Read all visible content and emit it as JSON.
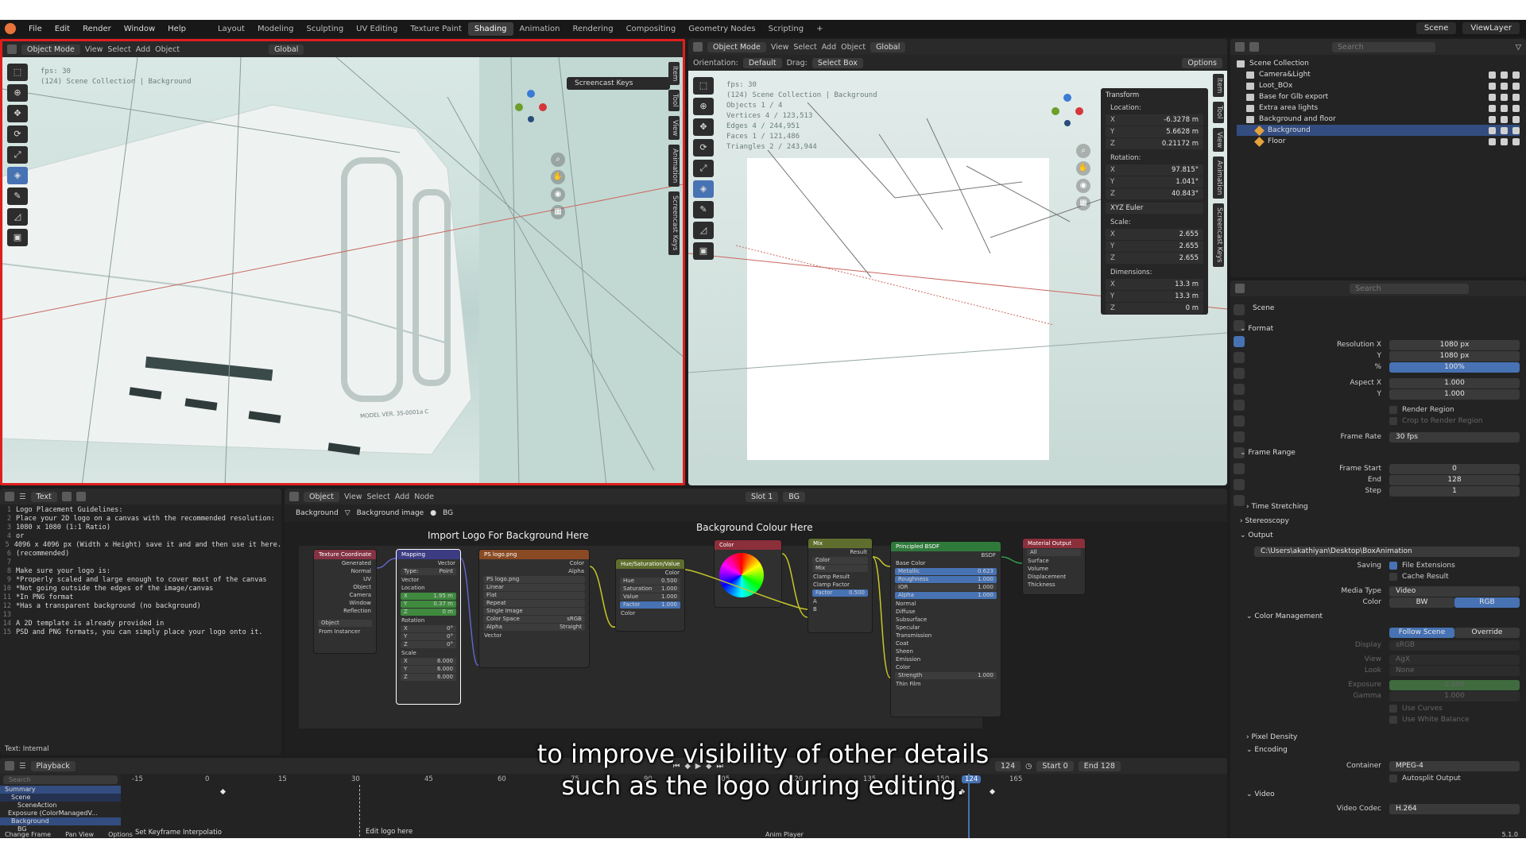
{
  "topbar": {
    "menus": [
      "File",
      "Edit",
      "Render",
      "Window",
      "Help"
    ],
    "workspaces": [
      "Layout",
      "Modeling",
      "Sculpting",
      "UV Editing",
      "Texture Paint",
      "Shading",
      "Animation",
      "Rendering",
      "Compositing",
      "Geometry Nodes",
      "Scripting"
    ],
    "active_workspace": "Shading",
    "scene": "Scene",
    "view_layer": "ViewLayer"
  },
  "viewport_left": {
    "mode": "Object Mode",
    "menus": [
      "View",
      "Select",
      "Add",
      "Object"
    ],
    "transform": "Global",
    "info_fps": "fps: 30",
    "info_collection": "(124) Scene Collection | Background",
    "screencast": "Screencast Keys",
    "side_tabs": [
      "Item",
      "Tool",
      "View",
      "Animation",
      "Screencast Keys"
    ],
    "model_text": "MODEL VER. 3S-0001a C"
  },
  "viewport_right": {
    "mode": "Object Mode",
    "menus": [
      "View",
      "Select",
      "Add",
      "Object"
    ],
    "transform": "Global",
    "orientation_label": "Orientation:",
    "orientation": "Default",
    "drag_label": "Drag:",
    "drag": "Select Box",
    "options": "Options",
    "info_lines": [
      "fps: 30",
      "(124) Scene Collection | Background",
      "Objects   1 / 4",
      "Vertices   4 / 123,513",
      "Edges   4 / 244,951",
      "Faces   1 / 121,486",
      "Triangles   2 / 243,944"
    ],
    "side_tabs": [
      "Item",
      "Tool",
      "View",
      "Animation",
      "Screencast Keys"
    ]
  },
  "transform_panel": {
    "title": "Transform",
    "location_label": "Location:",
    "location": [
      {
        "k": "X",
        "v": "-6.3278 m"
      },
      {
        "k": "Y",
        "v": "5.6628 m"
      },
      {
        "k": "Z",
        "v": "0.21172 m"
      }
    ],
    "rotation_label": "Rotation:",
    "rotation": [
      {
        "k": "X",
        "v": "97.815°"
      },
      {
        "k": "Y",
        "v": "1.041°"
      },
      {
        "k": "Z",
        "v": "40.843°"
      }
    ],
    "rotation_mode": "XYZ Euler",
    "scale_label": "Scale:",
    "scale": [
      {
        "k": "X",
        "v": "2.655"
      },
      {
        "k": "Y",
        "v": "2.655"
      },
      {
        "k": "Z",
        "v": "2.655"
      }
    ],
    "dimensions_label": "Dimensions:",
    "dimensions": [
      {
        "k": "X",
        "v": "13.3 m"
      },
      {
        "k": "Y",
        "v": "13.3 m"
      },
      {
        "k": "Z",
        "v": "0 m"
      }
    ]
  },
  "outliner": {
    "search_placeholder": "Search",
    "root": "Scene Collection",
    "items": [
      {
        "label": "Camera&Light",
        "indent": 1,
        "type": "coll"
      },
      {
        "label": "Loot_BOx",
        "indent": 1,
        "type": "coll"
      },
      {
        "label": "Base for Glb export",
        "indent": 1,
        "type": "coll"
      },
      {
        "label": "Extra area lights",
        "indent": 1,
        "type": "coll"
      },
      {
        "label": "Background and floor",
        "indent": 1,
        "type": "coll"
      },
      {
        "label": "Background",
        "indent": 2,
        "type": "obj",
        "selected": true
      },
      {
        "label": "Floor",
        "indent": 2,
        "type": "obj"
      }
    ]
  },
  "properties": {
    "search_placeholder": "Search",
    "context": "Scene",
    "format": "Format",
    "resolution_x_label": "Resolution X",
    "resolution_x": "1080 px",
    "resolution_y_label": "Y",
    "resolution_y": "1080 px",
    "percent_label": "%",
    "percent": "100%",
    "aspect_x_label": "Aspect X",
    "aspect_x": "1.000",
    "aspect_y_label": "Y",
    "aspect_y": "1.000",
    "render_region": "Render Region",
    "crop_region": "Crop to Render Region",
    "frame_rate_label": "Frame Rate",
    "frame_rate": "30 fps",
    "frame_range": "Frame Range",
    "frame_start_label": "Frame Start",
    "frame_start": "0",
    "frame_end_label": "End",
    "frame_end": "128",
    "step_label": "Step",
    "step": "1",
    "time_stretching": "Time Stretching",
    "stereoscopy": "Stereoscopy",
    "output": "Output",
    "output_path": "C:\\Users\\akathiyan\\Desktop\\BoxAnimation",
    "saving_label": "Saving",
    "file_extensions": "File Extensions",
    "cache_result": "Cache Result",
    "media_type_label": "Media Type",
    "media_type": "Video",
    "color_label": "Color",
    "color_bw": "BW",
    "color_rgb": "RGB",
    "color_management": "Color Management",
    "follow_scene": "Follow Scene",
    "override": "Override",
    "display_label": "Display",
    "display": "sRGB",
    "view_label": "View",
    "view": "AgX",
    "look_label": "Look",
    "look": "None",
    "exposure_label": "Exposure",
    "exposure": "0.000",
    "gamma_label": "Gamma",
    "gamma": "1.000",
    "use_curves": "Use Curves",
    "use_white_balance": "Use White Balance",
    "pixel_density": "Pixel Density",
    "encoding": "Encoding",
    "container_label": "Container",
    "container": "MPEG-4",
    "autosplit": "Autosplit Output",
    "video": "Video",
    "video_codec_label": "Video Codec",
    "video_codec": "H.264"
  },
  "text_editor": {
    "file": "Text",
    "footer": "Text: Internal",
    "lines": [
      "Logo Placement Guidelines:",
      "Place your 2D logo on a canvas with the recommended resolution:",
      "1080 x 1080 (1:1 Ratio)",
      "or",
      "4096 x 4096 px (Width x Height) save it and and then use it here.",
      "(recommended)",
      "",
      "Make sure your logo is:",
      "*Properly scaled and large enough to cover most of the canvas",
      "*Not going outside the edges of the image/canvas",
      "*In PNG format",
      "*Has a transparent background (no background)",
      "",
      "A 2D template is already provided in",
      "PSD and PNG formats, you can simply place your logo onto it."
    ]
  },
  "node_editor": {
    "mode": "Object",
    "menus": [
      "View",
      "Select",
      "Add",
      "Node"
    ],
    "slot": "Slot 1",
    "material": "BG",
    "breadcrumb": [
      "Background",
      "Background image",
      "BG"
    ],
    "frame1_label": "Import Logo For Background Here",
    "frame2_label": "Background Colour Here",
    "nodes": {
      "texcoord": {
        "title": "Texture Coordinate",
        "outputs": [
          "Generated",
          "Normal",
          "UV",
          "Object",
          "Camera",
          "Window",
          "Reflection"
        ],
        "object": "Object",
        "from_instancer": "From Instancer"
      },
      "mapping": {
        "title": "Mapping",
        "out": "Vector",
        "type_label": "Type:",
        "type": "Point",
        "vector": "Vector",
        "location": "Location",
        "loc": [
          {
            "k": "X",
            "v": "1.95 m"
          },
          {
            "k": "Y",
            "v": "0.37 m"
          },
          {
            "k": "Z",
            "v": "0 m"
          }
        ],
        "rotation": "Rotation",
        "rot": [
          {
            "k": "X",
            "v": "0°"
          },
          {
            "k": "Y",
            "v": "0°"
          },
          {
            "k": "Z",
            "v": "0°"
          }
        ],
        "scale": "Scale",
        "scl": [
          {
            "k": "X",
            "v": "6.000"
          },
          {
            "k": "Y",
            "v": "6.000"
          },
          {
            "k": "Z",
            "v": "6.000"
          }
        ]
      },
      "image": {
        "title": "PS logo.png",
        "out_color": "Color",
        "out_alpha": "Alpha",
        "file": "PS logo.png",
        "interp": "Linear",
        "proj": "Flat",
        "ext": "Repeat",
        "source": "Single Image",
        "colorspace_label": "Color Space",
        "colorspace": "sRGB",
        "alpha_label": "Alpha",
        "alpha": "Straight",
        "vector": "Vector"
      },
      "hsv": {
        "title": "Hue/Saturation/Value",
        "out": "Color",
        "fields": [
          {
            "k": "Hue",
            "v": "0.500"
          },
          {
            "k": "Saturation",
            "v": "1.000"
          },
          {
            "k": "Value",
            "v": "1.000"
          },
          {
            "k": "Factor",
            "v": "1.000"
          }
        ],
        "in": "Color"
      },
      "color": {
        "title": "Color"
      },
      "mix": {
        "title": "Mix",
        "out": "Result",
        "type": "Color",
        "blend": "Mix",
        "clamp_result": "Clamp Result",
        "clamp_factor": "Clamp Factor",
        "factor_label": "Factor",
        "factor": "0.500",
        "a": "A",
        "b": "B"
      },
      "bsdf": {
        "title": "Principled BSDF",
        "out": "BSDF",
        "base_color": "Base Color",
        "fields": [
          {
            "k": "Metallic",
            "v": "0.623"
          },
          {
            "k": "Roughness",
            "v": "1.000"
          },
          {
            "k": "IOR",
            "v": "1.000"
          },
          {
            "k": "Alpha",
            "v": "1.000"
          }
        ],
        "normal": "Normal",
        "subs": [
          "Diffuse",
          "Subsurface",
          "Specular",
          "Transmission",
          "Coat",
          "Sheen",
          "Emission"
        ],
        "color": "Color",
        "strength_label": "Strength",
        "strength": "1.000",
        "thin_film": "Thin Film"
      },
      "output": {
        "title": "Material Output",
        "target": "All",
        "inputs": [
          "Surface",
          "Volume",
          "Displacement",
          "Thickness"
        ]
      }
    }
  },
  "timeline": {
    "mode": "Playback",
    "search_placeholder": "Search",
    "current_frame": "124",
    "start_label": "Start",
    "start": "0",
    "end_label": "End",
    "end": "128",
    "ruler": [
      "-15",
      "0",
      "15",
      "30",
      "45",
      "60",
      "75",
      "90",
      "105",
      "120",
      "135",
      "150",
      "165"
    ],
    "rows": [
      "Summary",
      "Scene",
      "SceneAction",
      "Exposure (ColorManagedV...",
      "Background",
      "BG"
    ],
    "interp": "Set Keyframe Interpolatio",
    "marker": "Edit logo here",
    "playhead_label": "124"
  },
  "status": {
    "items": [
      "Change Frame",
      "Pan View",
      "Options"
    ],
    "center": "Anim Player",
    "version": "5.1.0"
  },
  "subtitle": {
    "line1": "to improve visibility of other details",
    "line2": "such as the logo during editing."
  }
}
